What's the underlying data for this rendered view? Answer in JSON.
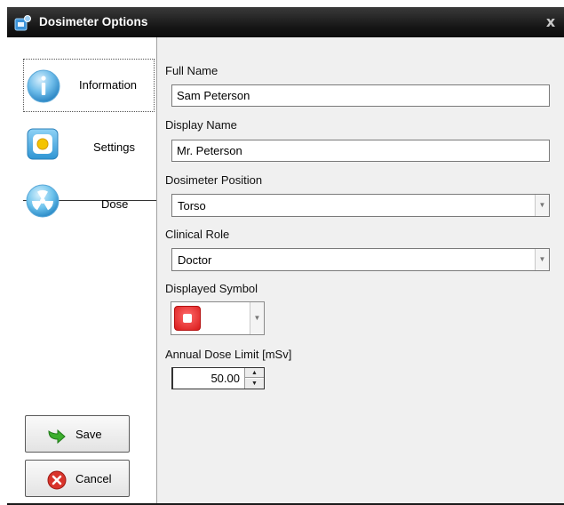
{
  "window": {
    "title": "Dosimeter Options",
    "close": "x"
  },
  "nav": {
    "items": [
      {
        "label": "Information",
        "icon": "info-icon",
        "selected": true
      },
      {
        "label": "Settings",
        "icon": "settings-icon",
        "selected": false
      },
      {
        "label": "Dose",
        "icon": "radiation-icon",
        "selected": false
      }
    ]
  },
  "buttons": {
    "save": "Save",
    "cancel": "Cancel"
  },
  "form": {
    "full_name": {
      "label": "Full Name",
      "value": "Sam Peterson"
    },
    "display_name": {
      "label": "Display Name",
      "value": "Mr. Peterson"
    },
    "position": {
      "label": "Dosimeter Position",
      "value": "Torso"
    },
    "role": {
      "label": "Clinical Role",
      "value": "Doctor"
    },
    "symbol": {
      "label": "Displayed Symbol",
      "color": "#e52525"
    },
    "dose_limit": {
      "label": "Annual Dose Limit [mSv]",
      "value": "50.00"
    }
  },
  "colors": {
    "titlebar": "#151515",
    "panel": "#f0f0f0",
    "accent": "#2a8fd6"
  }
}
